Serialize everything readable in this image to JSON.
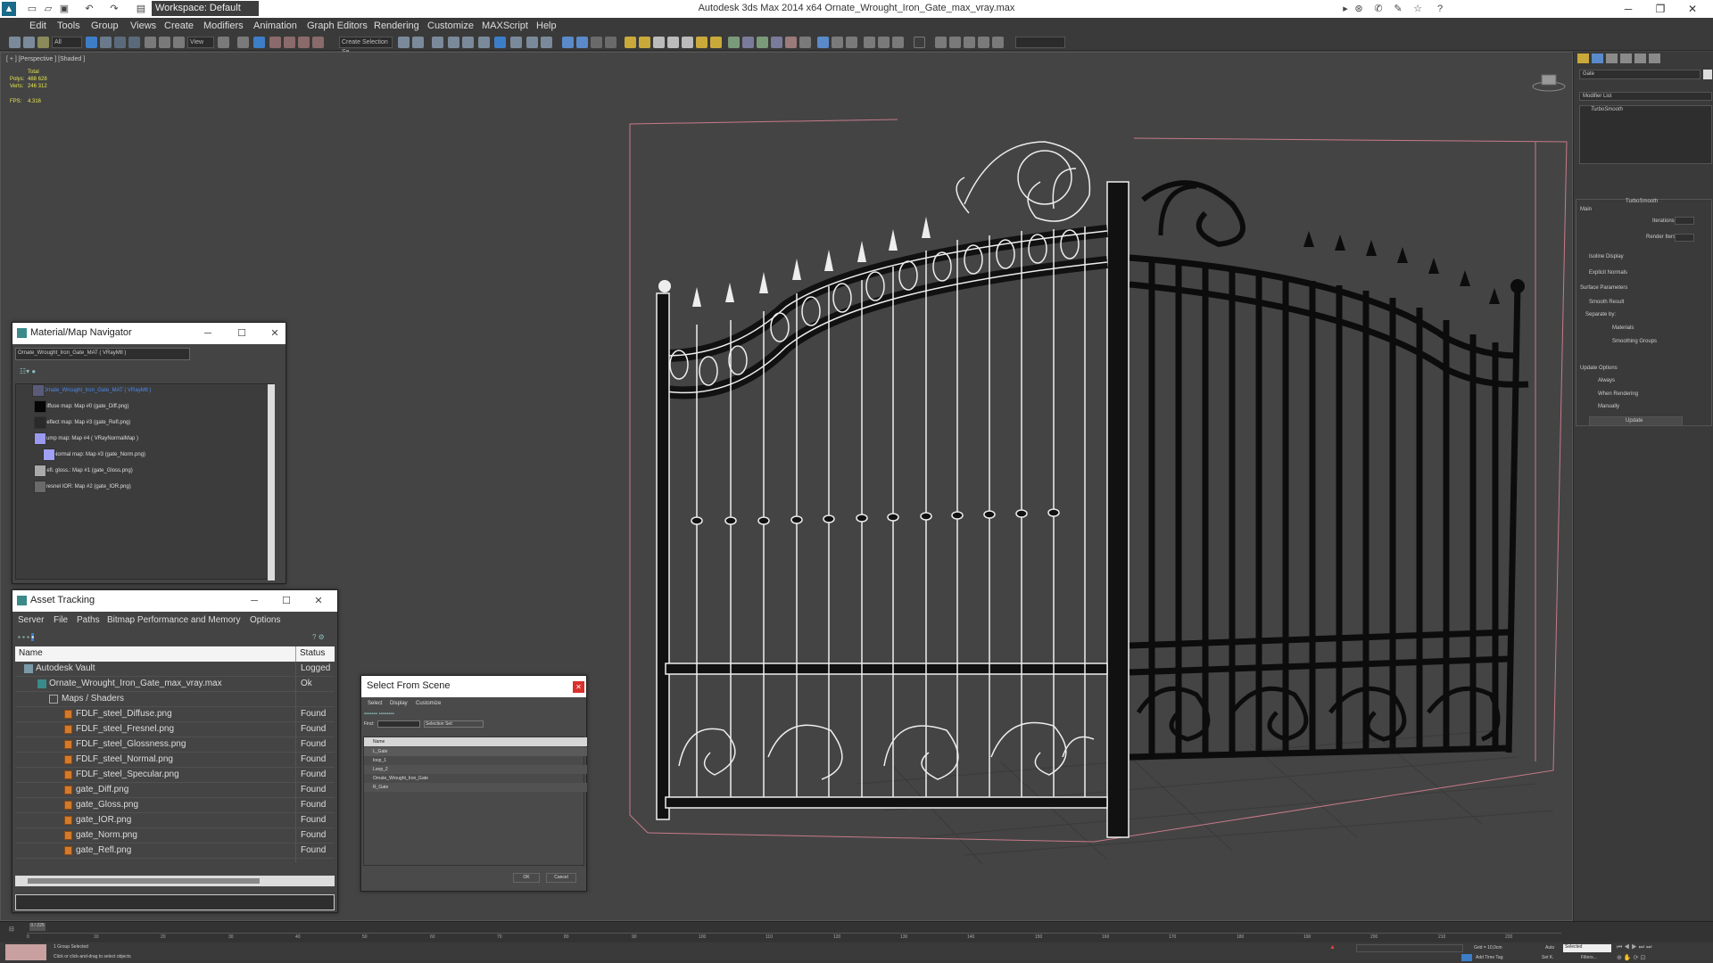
{
  "app": {
    "title": "Autodesk 3ds Max  2014 x64     Ornate_Wrought_Iron_Gate_max_vray.max",
    "workspace": "Workspace: Default"
  },
  "menu": [
    "Edit",
    "Tools",
    "Group",
    "Views",
    "Create",
    "Modifiers",
    "Animation",
    "Graph Editors",
    "Rendering",
    "Customize",
    "MAXScript",
    "Help"
  ],
  "toolbar": {
    "selection_filter": "All",
    "ref_coord": "View",
    "named_selection": "Create Selection Se"
  },
  "viewport": {
    "label": "[ + ] [Perspective ] [Shaded ]",
    "stats_total": "Total",
    "stats_polys_label": "Polys:",
    "stats_polys": "488 628",
    "stats_verts_label": "Verts:",
    "stats_verts": "246 312",
    "fps_label": "FPS:",
    "fps": "4.316"
  },
  "command_panel": {
    "object_name": "Gate",
    "modifier_list": "Modifier List",
    "modifier": "TurboSmooth",
    "rollout_title": "TurboSmooth",
    "main": "Main",
    "iterations": "Iterations:",
    "render_iters": "Render Iters:",
    "isoline": "Isoline Display",
    "explicit": "Explicit Normals",
    "surface": "Surface Parameters",
    "smooth_result": "Smooth Result",
    "separate_by": "Separate by:",
    "materials": "Materials",
    "smoothing_groups": "Smoothing Groups",
    "update_options": "Update Options",
    "always": "Always",
    "when_rendering": "When Rendering",
    "manually": "Manually",
    "update_btn": "Update"
  },
  "material_navigator": {
    "title": "Material/Map Navigator",
    "material_field": "Ornate_Wrought_Iron_Gate_MAT  ( VRayMtl )",
    "items": [
      "Ornate_Wrought_Iron_Gate_MAT  ( VRayMtl )",
      "Diffuse map: Map #0 (gate_Diff.png)",
      "Reflect map: Map #3 (gate_Refl.png)",
      "Bump map: Map #4  ( VRayNormalMap )",
      "Normal map: Map #3 (gate_Norm.png)",
      "Refl. gloss.: Map #1 (gate_Gloss.png)",
      "Fresnel IOR: Map #2 (gate_IOR.png)"
    ]
  },
  "asset_tracking": {
    "title": "Asset Tracking",
    "menus": [
      "Server",
      "File",
      "Paths",
      "Bitmap Performance and Memory",
      "Options"
    ],
    "col_name": "Name",
    "col_status": "Status",
    "rows": [
      {
        "name": "Autodesk Vault",
        "status": "Logged",
        "indent": 0
      },
      {
        "name": "Ornate_Wrought_Iron_Gate_max_vray.max",
        "status": "Ok",
        "indent": 1
      },
      {
        "name": "Maps / Shaders",
        "status": "",
        "indent": 2
      },
      {
        "name": "FDLF_steel_Diffuse.png",
        "status": "Found",
        "indent": 3
      },
      {
        "name": "FDLF_steel_Fresnel.png",
        "status": "Found",
        "indent": 3
      },
      {
        "name": "FDLF_steel_Glossness.png",
        "status": "Found",
        "indent": 3
      },
      {
        "name": "FDLF_steel_Normal.png",
        "status": "Found",
        "indent": 3
      },
      {
        "name": "FDLF_steel_Specular.png",
        "status": "Found",
        "indent": 3
      },
      {
        "name": "gate_Diff.png",
        "status": "Found",
        "indent": 3
      },
      {
        "name": "gate_Gloss.png",
        "status": "Found",
        "indent": 3
      },
      {
        "name": "gate_IOR.png",
        "status": "Found",
        "indent": 3
      },
      {
        "name": "gate_Norm.png",
        "status": "Found",
        "indent": 3
      },
      {
        "name": "gate_Refl.png",
        "status": "Found",
        "indent": 3
      }
    ]
  },
  "select_from_scene": {
    "title": "Select From Scene",
    "menus": [
      "Select",
      "Display",
      "Customize"
    ],
    "find_label": "Find:",
    "selection_set": "Selection Set:",
    "col_name": "Name",
    "items": [
      "L_Gate",
      "loop_1",
      "Loop_2",
      "Ornate_Wrought_Iron_Gate",
      "R_Gate"
    ],
    "ok": "OK",
    "cancel": "Cancel"
  },
  "timeline": {
    "frame": "0 / 225",
    "ticks": [
      "0",
      "10",
      "20",
      "30",
      "40",
      "50",
      "60",
      "70",
      "80",
      "90",
      "100",
      "110",
      "120",
      "130",
      "140",
      "150",
      "160",
      "170",
      "180",
      "190",
      "200",
      "210",
      "220"
    ]
  },
  "status": {
    "selected": "1 Group Selected",
    "hint": "Click or click-and-drag to select objects",
    "grid": "Grid = 10,0cm",
    "auto": "Auto",
    "selected_dd": "Selected",
    "set_key": "Set K.",
    "filters": "Filters...",
    "add_time_tag": "Add Time Tag"
  }
}
